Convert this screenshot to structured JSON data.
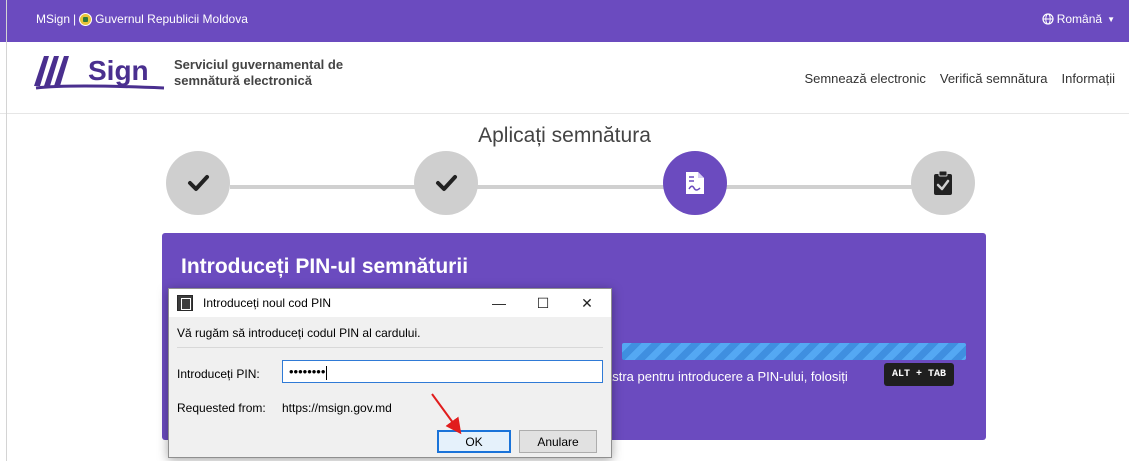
{
  "topbar": {
    "brand": "MSign",
    "separator": "|",
    "gov": "Guvernul Republicii Moldova",
    "language": "Română",
    "colors": {
      "purple": "#6b4bbf"
    }
  },
  "header": {
    "logo_text": "Sign",
    "tagline_line1": "Serviciul guvernamental de",
    "tagline_line2": "semnătură electronică",
    "nav": [
      "Semnează electronic",
      "Verifică semnătura",
      "Informații"
    ]
  },
  "page": {
    "title": "Aplicați semnătura",
    "steps": [
      {
        "state": "done",
        "icon": "check-icon"
      },
      {
        "state": "done",
        "icon": "check-icon"
      },
      {
        "state": "active",
        "icon": "document-signature-icon"
      },
      {
        "state": "pending",
        "icon": "clipboard-check-icon"
      }
    ]
  },
  "card": {
    "title": "Introduceți PIN-ul semnăturii",
    "hint": "astra pentru introducere a PIN-ului, folosiți",
    "shortcut": "ALT + TAB"
  },
  "dialog": {
    "title": "Introduceți noul cod PIN",
    "message": "Vă rugăm să introduceți codul PIN al cardului.",
    "pin_label": "Introduceți PIN:",
    "pin_value": "••••••••",
    "requested_label": "Requested from:",
    "requested_value": "https://msign.gov.md",
    "ok": "OK",
    "cancel": "Anulare",
    "minimize": "—",
    "maximize": "☐",
    "close": "✕"
  }
}
